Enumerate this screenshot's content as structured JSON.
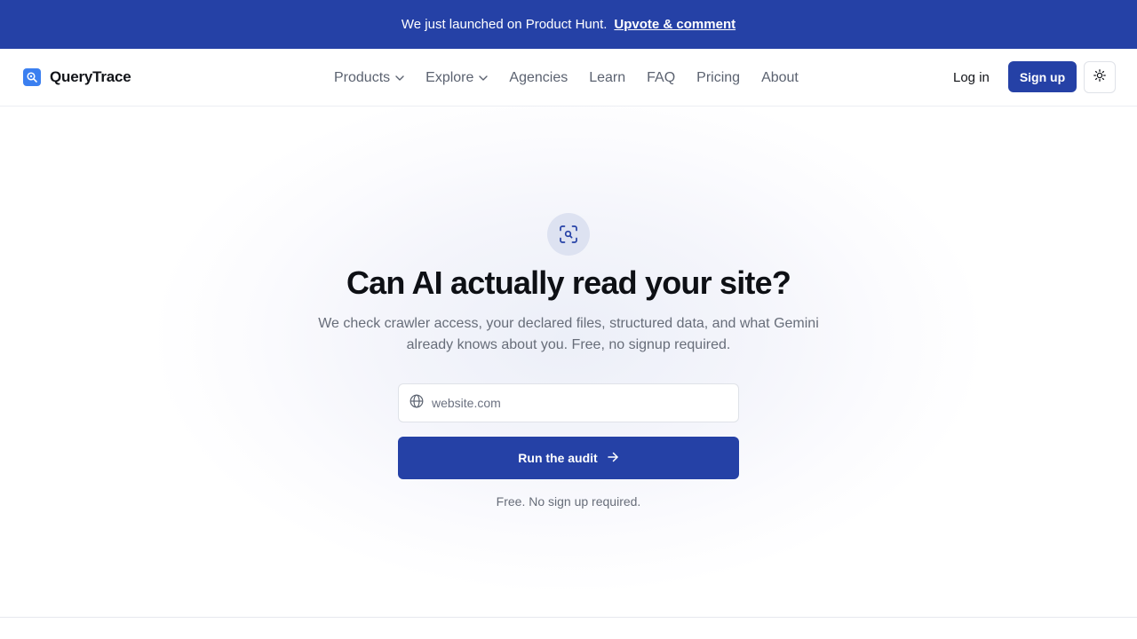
{
  "announcement": {
    "text": "We just launched on Product Hunt.",
    "link_label": "Upvote & comment"
  },
  "brand": {
    "name": "QueryTrace",
    "accent": "#2541a6",
    "logo_color": "#3b7ff0"
  },
  "nav": {
    "items": [
      {
        "label": "Products",
        "icon": "chevron-down-icon"
      },
      {
        "label": "Explore",
        "icon": "chevron-down-icon"
      },
      {
        "label": "Agencies"
      },
      {
        "label": "Learn"
      },
      {
        "label": "FAQ"
      },
      {
        "label": "Pricing"
      },
      {
        "label": "About"
      }
    ],
    "login_label": "Log in",
    "signup_label": "Sign up",
    "theme_icon": "sun-icon"
  },
  "hero": {
    "icon": "scan-search-icon",
    "title": "Can AI actually read your site?",
    "subtitle": "We check crawler access, your declared files, structured data, and what Gemini already knows about you. Free, no signup required.",
    "input_icon": "globe-icon",
    "input_placeholder": "website.com",
    "input_value": "",
    "button_label": "Run the audit",
    "button_icon": "arrow-right-icon",
    "note": "Free. No sign up required."
  }
}
